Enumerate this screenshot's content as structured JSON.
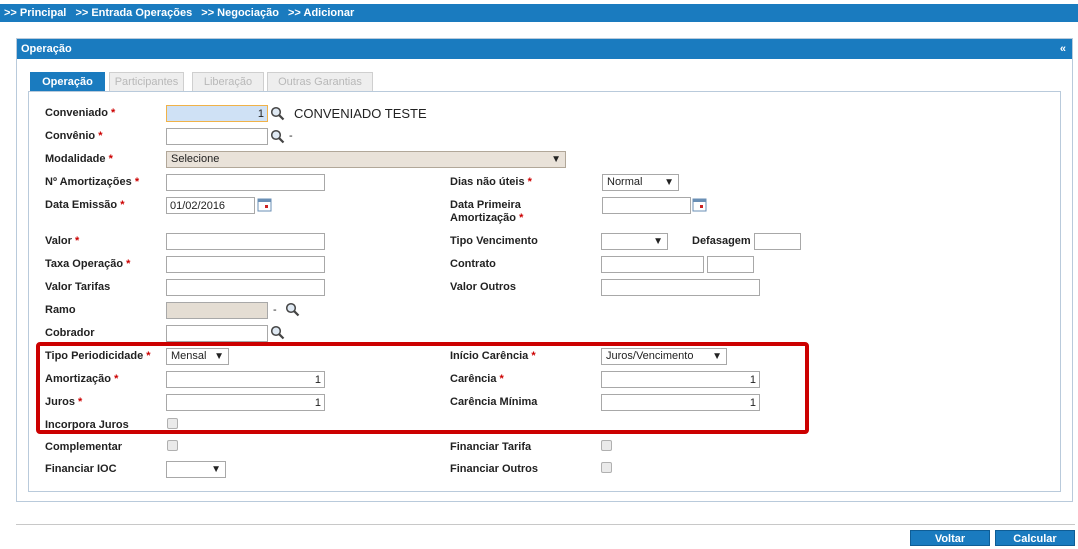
{
  "breadcrumb": {
    "items": [
      ">> Principal",
      ">> Entrada Operações",
      ">> Negociação",
      ">> Adicionar"
    ]
  },
  "panel": {
    "title": "Operação",
    "collapse_label": "«"
  },
  "tabs": [
    {
      "label": "Operação",
      "active": true
    },
    {
      "label": "Participantes",
      "active": false
    },
    {
      "label": "Liberação",
      "active": false
    },
    {
      "label": "Outras Garantias",
      "active": false
    }
  ],
  "form": {
    "required_mark": "*",
    "conveniado": {
      "label": "Conveniado",
      "value": "1",
      "display": "CONVENIADO TESTE"
    },
    "convenio": {
      "label": "Convênio",
      "value": "",
      "display": "-"
    },
    "modalidade": {
      "label": "Modalidade",
      "value": "Selecione"
    },
    "num_amortizacoes": {
      "label": "Nº Amortizações",
      "value": ""
    },
    "dias_nao_uteis": {
      "label": "Dias não úteis",
      "value": "Normal"
    },
    "data_emissao": {
      "label": "Data Emissão",
      "value": "01/02/2016"
    },
    "data_primeira_amortizacao": {
      "label_line1": "Data Primeira",
      "label_line2": "Amortização",
      "value": ""
    },
    "valor": {
      "label": "Valor",
      "value": ""
    },
    "tipo_vencimento": {
      "label": "Tipo Vencimento",
      "value": ""
    },
    "defasagem": {
      "label": "Defasagem",
      "value": ""
    },
    "taxa_operacao": {
      "label": "Taxa Operação",
      "value": ""
    },
    "contrato": {
      "label": "Contrato",
      "value1": "",
      "value2": ""
    },
    "valor_tarifas": {
      "label": "Valor Tarifas",
      "value": ""
    },
    "valor_outros": {
      "label": "Valor Outros",
      "value": ""
    },
    "ramo": {
      "label": "Ramo",
      "value": "",
      "display": "-"
    },
    "cobrador": {
      "label": "Cobrador",
      "value": ""
    },
    "tipo_periodicidade": {
      "label": "Tipo Periodicidade",
      "value": "Mensal"
    },
    "inicio_carencia": {
      "label": "Início Carência",
      "value": "Juros/Vencimento"
    },
    "amortizacao": {
      "label": "Amortização",
      "value": "1"
    },
    "carencia": {
      "label": "Carência",
      "value": "1"
    },
    "juros": {
      "label": "Juros",
      "value": "1"
    },
    "carencia_minima": {
      "label": "Carência Mínima",
      "value": "1"
    },
    "incorpora_juros": {
      "label": "Incorpora Juros",
      "checked": false
    },
    "complementar": {
      "label": "Complementar",
      "checked": false
    },
    "financiar_tarifa": {
      "label": "Financiar Tarifa",
      "checked": false
    },
    "financiar_ioc": {
      "label": "Financiar IOC",
      "value": ""
    },
    "financiar_outros": {
      "label": "Financiar Outros",
      "checked": false
    }
  },
  "buttons": {
    "voltar": "Voltar",
    "calcular": "Calcular"
  },
  "colors": {
    "primary": "#1a7bbf",
    "required": "#cc0000",
    "highlight": "#cc0000"
  }
}
